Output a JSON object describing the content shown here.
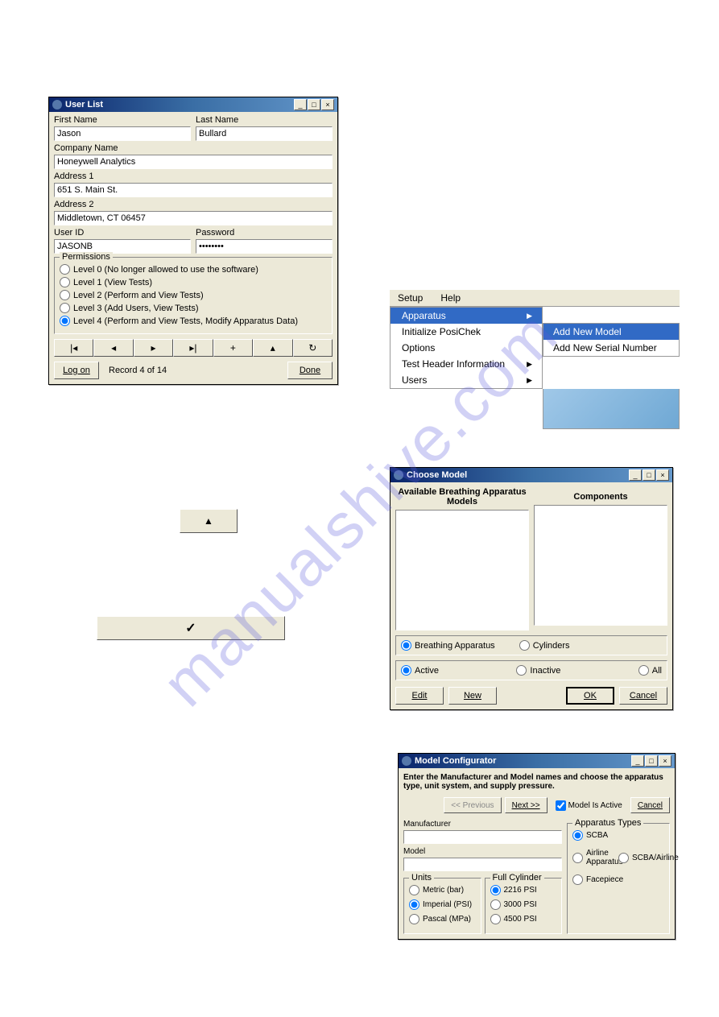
{
  "user_list": {
    "title": "User List",
    "labels": {
      "first_name": "First Name",
      "last_name": "Last Name",
      "company_name": "Company Name",
      "address1": "Address 1",
      "address2": "Address 2",
      "user_id": "User ID",
      "password": "Password",
      "permissions": "Permissions"
    },
    "values": {
      "first_name": "Jason",
      "last_name": "Bullard",
      "company_name": "Honeywell Analytics",
      "address1": "651 S. Main St.",
      "address2": "Middletown, CT 06457",
      "user_id": "JASONB",
      "password": "••••••••"
    },
    "permissions": [
      "Level 0 (No longer allowed to use the software)",
      "Level 1 (View Tests)",
      "Level 2 (Perform and View Tests)",
      "Level 3 (Add Users, View Tests)",
      "Level 4 (Perform and View Tests, Modify Apparatus Data)"
    ],
    "selected_permission": 4,
    "record_status": "Record 4 of 14",
    "buttons": {
      "log_on": "Log on",
      "done": "Done"
    }
  },
  "menu": {
    "top": [
      "Setup",
      "Help"
    ],
    "open_index": 0,
    "items": [
      {
        "label": "Apparatus",
        "has_sub": true,
        "selected": true
      },
      {
        "label": "Initialize PosiChek"
      },
      {
        "label": "Options"
      },
      {
        "label": "Test Header Information",
        "has_sub": true
      },
      {
        "label": "Users",
        "has_sub": true
      }
    ],
    "submenu": [
      {
        "label": "Add New Model",
        "selected": true
      },
      {
        "label": "Add New Serial Number"
      }
    ]
  },
  "choose_model": {
    "title": "Choose Model",
    "headers": {
      "left": "Available Breathing Apparatus Models",
      "right": "Components"
    },
    "type_filters": [
      {
        "label": "Breathing Apparatus",
        "checked": true
      },
      {
        "label": "Cylinders",
        "checked": false
      }
    ],
    "state_filters": [
      {
        "label": "Active",
        "checked": true
      },
      {
        "label": "Inactive",
        "checked": false
      },
      {
        "label": "All",
        "checked": false
      }
    ],
    "buttons": {
      "edit": "Edit",
      "new": "New",
      "ok": "OK",
      "cancel": "Cancel"
    }
  },
  "model_config": {
    "title": "Model Configurator",
    "instruction": "Enter the Manufacturer and Model names and choose the apparatus type, unit system, and supply pressure.",
    "buttons": {
      "prev": "<< Previous",
      "next": "Next >>",
      "cancel": "Cancel"
    },
    "active_checkbox": "Model Is Active",
    "labels": {
      "manufacturer": "Manufacturer",
      "model": "Model",
      "units": "Units",
      "full_cylinder": "Full Cylinder",
      "apparatus_types": "Apparatus Types"
    },
    "units": [
      {
        "label": "Metric (bar)",
        "checked": false
      },
      {
        "label": "Imperial (PSI)",
        "checked": true
      },
      {
        "label": "Pascal (MPa)",
        "checked": false
      }
    ],
    "full_cylinder": [
      {
        "label": "2216 PSI",
        "checked": true
      },
      {
        "label": "3000 PSI",
        "checked": false
      },
      {
        "label": "4500 PSI",
        "checked": false
      }
    ],
    "apparatus_types": [
      {
        "label": "SCBA",
        "checked": true
      },
      {
        "label": "Airline Apparatus",
        "checked": false
      },
      {
        "label": "SCBA/Airline",
        "checked": false
      },
      {
        "label": "Facepiece",
        "checked": false
      }
    ]
  },
  "watermark": "manualshive.com"
}
